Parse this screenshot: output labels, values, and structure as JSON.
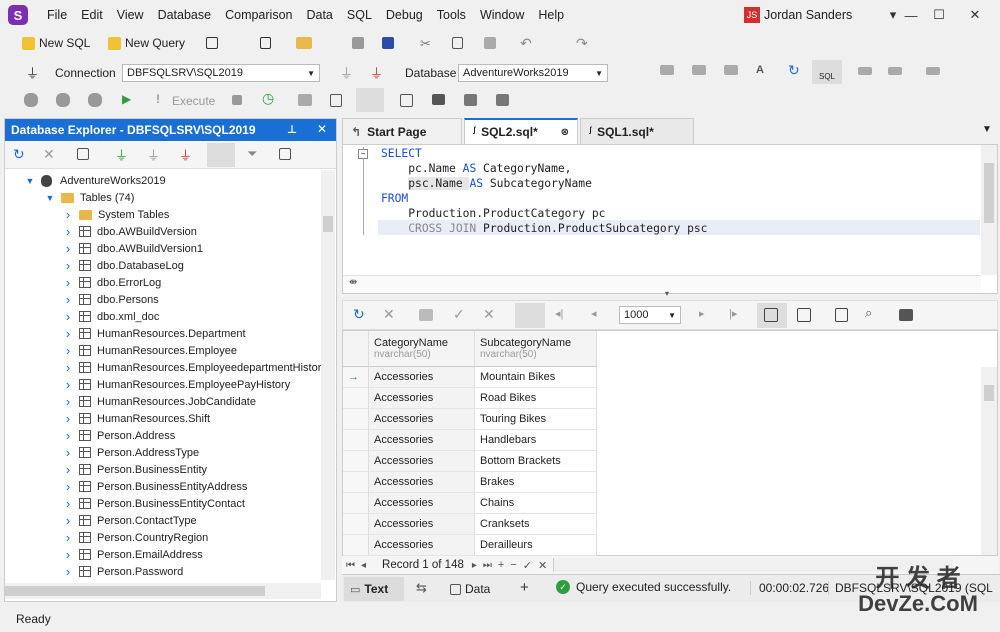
{
  "app": {
    "logo": "S"
  },
  "menu": [
    "File",
    "Edit",
    "View",
    "Database",
    "Comparison",
    "Data",
    "SQL",
    "Debug",
    "Tools",
    "Window",
    "Help"
  ],
  "user": {
    "initials": "JS",
    "name": "Jordan Sanders"
  },
  "window_controls": {
    "dropdown": "▾",
    "minimize": "—",
    "maximize": "☐",
    "close": "✕"
  },
  "toolbar1": {
    "new_sql": "New SQL",
    "new_query": "New Query"
  },
  "toolbar2": {
    "connection_label": "Connection",
    "connection_value": "DBFSQLSRV\\SQL2019",
    "database_label": "Database",
    "database_value": "AdventureWorks2019"
  },
  "toolbar3": {
    "execute": "Execute"
  },
  "explorer": {
    "title": "Database Explorer - DBFSQLSRV\\SQL2019",
    "database": "AdventureWorks2019",
    "tables_folder": "Tables (74)",
    "system_tables": "System Tables",
    "tables": [
      "dbo.AWBuildVersion",
      "dbo.AWBuildVersion1",
      "dbo.DatabaseLog",
      "dbo.ErrorLog",
      "dbo.Persons",
      "dbo.xml_doc",
      "HumanResources.Department",
      "HumanResources.Employee",
      "HumanResources.EmployeedepartmentHistor",
      "HumanResources.EmployeePayHistory",
      "HumanResources.JobCandidate",
      "HumanResources.Shift",
      "Person.Address",
      "Person.AddressType",
      "Person.BusinessEntity",
      "Person.BusinessEntityAddress",
      "Person.BusinessEntityContact",
      "Person.ContactType",
      "Person.CountryRegion",
      "Person.EmailAddress",
      "Person.Password"
    ]
  },
  "tabs": {
    "start": "Start Page",
    "sql2": "SQL2.sql*",
    "sql1": "SQL1.sql*"
  },
  "code": {
    "l1": "SELECT",
    "l2a": "pc.Name ",
    "l2kw": "AS",
    "l2b": " CategoryName,",
    "l3a": "psc.Name ",
    "l3kw": "AS",
    "l3b": " SubcategoryName",
    "l4": "FROM",
    "l5": "Production.ProductCategory pc",
    "l6kw": "CROSS JOIN",
    "l6b": " Production.ProductSubcategory psc"
  },
  "grid": {
    "page_size": "1000",
    "columns": [
      {
        "name": "CategoryName",
        "type": "nvarchar(50)"
      },
      {
        "name": "SubcategoryName",
        "type": "nvarchar(50)"
      }
    ],
    "rows": [
      [
        "Accessories",
        "Mountain Bikes"
      ],
      [
        "Accessories",
        "Road Bikes"
      ],
      [
        "Accessories",
        "Touring Bikes"
      ],
      [
        "Accessories",
        "Handlebars"
      ],
      [
        "Accessories",
        "Bottom Brackets"
      ],
      [
        "Accessories",
        "Brakes"
      ],
      [
        "Accessories",
        "Chains"
      ],
      [
        "Accessories",
        "Cranksets"
      ],
      [
        "Accessories",
        "Derailleurs"
      ]
    ],
    "record_text": "Record 1 of 148"
  },
  "bottom": {
    "text_tab": "Text",
    "data_tab": "Data",
    "status": "Query executed successfully.",
    "elapsed": "00:00:02.726",
    "server": "DBFSQLSRV\\SQL2019 (SQL"
  },
  "statusbar": {
    "ready": "Ready"
  },
  "watermark": {
    "line1": "开 发 者",
    "line2": "DevZe.CoM"
  },
  "colors": {
    "accent": "#1a6fd4",
    "logo": "#7a2fb3",
    "avatar": "#d32f2f",
    "keyword": "#1a4ed8",
    "success": "#2e9e3e"
  }
}
